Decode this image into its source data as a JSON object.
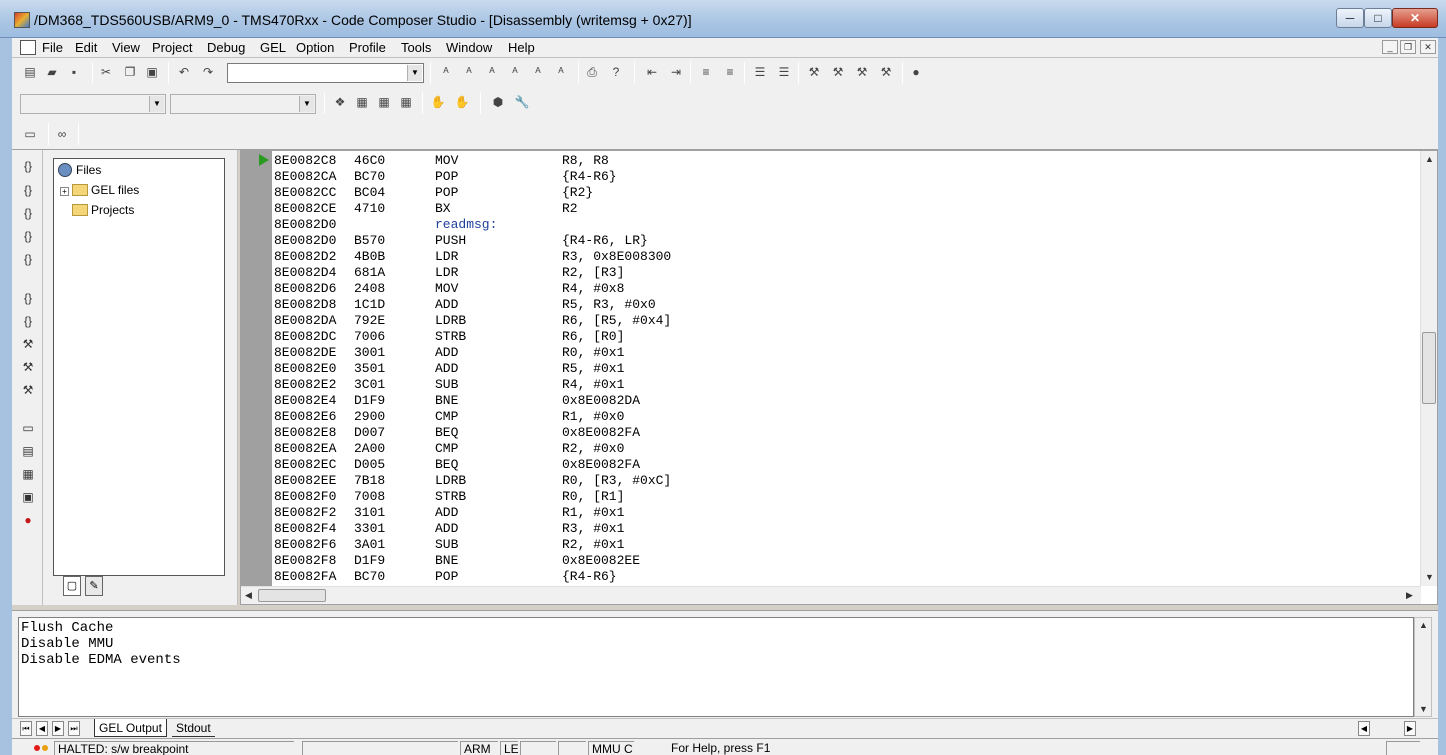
{
  "window": {
    "title": "/DM368_TDS560USB/ARM9_0 - TMS470Rxx - Code Composer Studio - [Disassembly (writemsg + 0x27)]",
    "minimize": "─",
    "maximize": "□",
    "close": "✕"
  },
  "menu": {
    "items": [
      "File",
      "Edit",
      "View",
      "Project",
      "Debug",
      "GEL",
      "Option",
      "Profile",
      "Tools",
      "Window",
      "Help"
    ],
    "mdi_min": "_",
    "mdi_restore": "❐",
    "mdi_close": "✕"
  },
  "toolbar": {
    "search_combo_value": ""
  },
  "project": {
    "root": "Files",
    "children": [
      "GEL files",
      "Projects"
    ]
  },
  "disassembly": {
    "pc_line": 0,
    "lines": [
      {
        "addr": "8E0082C8",
        "op": "46C0",
        "mn": "MOV",
        "args": "R8, R8"
      },
      {
        "addr": "8E0082CA",
        "op": "BC70",
        "mn": "POP",
        "args": "{R4-R6}"
      },
      {
        "addr": "8E0082CC",
        "op": "BC04",
        "mn": "POP",
        "args": "{R2}"
      },
      {
        "addr": "8E0082CE",
        "op": "4710",
        "mn": "BX",
        "args": "R2"
      },
      {
        "addr": "8E0082D0",
        "op": "",
        "mn": "readmsg:",
        "args": "",
        "label": true
      },
      {
        "addr": "8E0082D0",
        "op": "B570",
        "mn": "PUSH",
        "args": "{R4-R6, LR}"
      },
      {
        "addr": "8E0082D2",
        "op": "4B0B",
        "mn": "LDR",
        "args": "R3, 0x8E008300"
      },
      {
        "addr": "8E0082D4",
        "op": "681A",
        "mn": "LDR",
        "args": "R2, [R3]"
      },
      {
        "addr": "8E0082D6",
        "op": "2408",
        "mn": "MOV",
        "args": "R4, #0x8"
      },
      {
        "addr": "8E0082D8",
        "op": "1C1D",
        "mn": "ADD",
        "args": "R5, R3, #0x0"
      },
      {
        "addr": "8E0082DA",
        "op": "792E",
        "mn": "LDRB",
        "args": "R6, [R5, #0x4]"
      },
      {
        "addr": "8E0082DC",
        "op": "7006",
        "mn": "STRB",
        "args": "R6, [R0]"
      },
      {
        "addr": "8E0082DE",
        "op": "3001",
        "mn": "ADD",
        "args": "R0, #0x1"
      },
      {
        "addr": "8E0082E0",
        "op": "3501",
        "mn": "ADD",
        "args": "R5, #0x1"
      },
      {
        "addr": "8E0082E2",
        "op": "3C01",
        "mn": "SUB",
        "args": "R4, #0x1"
      },
      {
        "addr": "8E0082E4",
        "op": "D1F9",
        "mn": "BNE",
        "args": "0x8E0082DA"
      },
      {
        "addr": "8E0082E6",
        "op": "2900",
        "mn": "CMP",
        "args": "R1, #0x0"
      },
      {
        "addr": "8E0082E8",
        "op": "D007",
        "mn": "BEQ",
        "args": "0x8E0082FA"
      },
      {
        "addr": "8E0082EA",
        "op": "2A00",
        "mn": "CMP",
        "args": "R2, #0x0"
      },
      {
        "addr": "8E0082EC",
        "op": "D005",
        "mn": "BEQ",
        "args": "0x8E0082FA"
      },
      {
        "addr": "8E0082EE",
        "op": "7B18",
        "mn": "LDRB",
        "args": "R0, [R3, #0xC]"
      },
      {
        "addr": "8E0082F0",
        "op": "7008",
        "mn": "STRB",
        "args": "R0, [R1]"
      },
      {
        "addr": "8E0082F2",
        "op": "3101",
        "mn": "ADD",
        "args": "R1, #0x1"
      },
      {
        "addr": "8E0082F4",
        "op": "3301",
        "mn": "ADD",
        "args": "R3, #0x1"
      },
      {
        "addr": "8E0082F6",
        "op": "3A01",
        "mn": "SUB",
        "args": "R2, #0x1"
      },
      {
        "addr": "8E0082F8",
        "op": "D1F9",
        "mn": "BNE",
        "args": "0x8E0082EE"
      },
      {
        "addr": "8E0082FA",
        "op": "BC70",
        "mn": "POP",
        "args": "{R4-R6}"
      }
    ]
  },
  "output": {
    "lines": [
      "Flush Cache",
      "Disable MMU",
      "Disable EDMA events"
    ],
    "tabs": [
      "GEL Output",
      "Stdout"
    ]
  },
  "status": {
    "state": "HALTED: s/w breakpoint",
    "mode": "ARM",
    "endian": "LE",
    "mmu": "MMU C",
    "help": "For Help, press F1"
  },
  "colors": {
    "label": "#1f3f9a",
    "pc_arrow": "#2a9a20",
    "gutter": "#a0a0a0"
  }
}
